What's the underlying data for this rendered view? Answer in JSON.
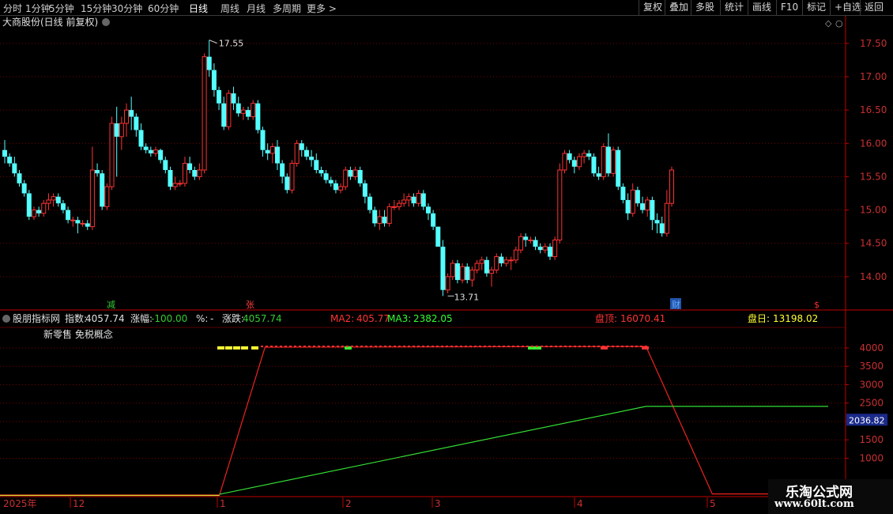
{
  "toolbar": {
    "periods": [
      "分时",
      "1分钟",
      "5分钟",
      "15分钟",
      "30分钟",
      "60分钟",
      "日线",
      "周线",
      "月线",
      "多周期",
      "更多 >"
    ],
    "active_period": "日线",
    "right_buttons": [
      "复权",
      "叠加",
      "多股",
      "统计",
      "画线",
      "F10",
      "标记",
      "+自选",
      "返回"
    ]
  },
  "main_panel": {
    "title": "大商股份(日线 前复权)",
    "y_axis_ticks": [
      "17.50",
      "17.00",
      "16.50",
      "16.00",
      "15.50",
      "15.00",
      "14.50",
      "14.00"
    ],
    "high_label": "17.55",
    "low_label": "13.71",
    "markers": [
      {
        "text": "减",
        "color": "#33cc33"
      },
      {
        "text": "张",
        "color": "#ff4040"
      },
      {
        "text": "财",
        "color": "#66aaff"
      },
      {
        "text": "$",
        "color": "#ff3030"
      }
    ]
  },
  "indicator_panel": {
    "name": "股朋指标网",
    "stats": [
      {
        "label": "指数:",
        "value": "4057.74",
        "color": "#e0e0e0"
      },
      {
        "label": "涨幅:",
        "value": "-100.00",
        "color": "#33cc33"
      },
      {
        "label": "%:",
        "value": "-",
        "color": "#e0e0e0"
      },
      {
        "label": "涨跌:",
        "value": "4057.74",
        "color": "#33cc33"
      }
    ],
    "ma": [
      {
        "label": "MA2:",
        "value": "405.77",
        "color": "#ff3333"
      },
      {
        "label": "MA3:",
        "value": "2382.05",
        "color": "#33ff33"
      }
    ],
    "pan_top": {
      "label": "盘顶:",
      "value": "16070.41",
      "color": "#ff3333"
    },
    "pan_day": {
      "label": "盘日:",
      "value": "13198.02",
      "color": "#ffff33"
    },
    "concept_label": "新零售 免税概念",
    "y_axis_ticks": [
      "4000",
      "3500",
      "3000",
      "2500",
      "2000",
      "1500",
      "1000"
    ],
    "current_value_box": "2036.82"
  },
  "x_axis": {
    "year_label": "2025年",
    "months": [
      "12",
      "1",
      "2",
      "3",
      "4",
      "5"
    ]
  },
  "watermark": {
    "line1": "乐淘公式网",
    "line2": "www.60lt.com"
  },
  "colors": {
    "up": "#ff3232",
    "down": "#54ffff",
    "grid": "#7a0000",
    "axis": "#c00000",
    "ma_green": "#33dd33",
    "ma_red": "#ee2222"
  },
  "chart_data": {
    "type": "candlestick",
    "ylim": [
      13.5,
      17.7
    ],
    "ohlc": [
      [
        15.9,
        16.05,
        15.7,
        15.8
      ],
      [
        15.8,
        15.85,
        15.65,
        15.7
      ],
      [
        15.7,
        15.8,
        15.5,
        15.55
      ],
      [
        15.55,
        15.6,
        15.35,
        15.4
      ],
      [
        15.4,
        15.45,
        15.2,
        15.25
      ],
      [
        15.25,
        15.3,
        14.85,
        14.9
      ],
      [
        14.9,
        15.05,
        14.85,
        15.0
      ],
      [
        15.0,
        15.05,
        14.9,
        14.95
      ],
      [
        14.95,
        15.15,
        14.9,
        15.1
      ],
      [
        15.1,
        15.25,
        15.0,
        15.15
      ],
      [
        15.15,
        15.25,
        15.05,
        15.2
      ],
      [
        15.2,
        15.25,
        15.05,
        15.1
      ],
      [
        15.1,
        15.15,
        14.95,
        15.0
      ],
      [
        15.0,
        15.05,
        14.8,
        14.85
      ],
      [
        14.85,
        14.9,
        14.75,
        14.85
      ],
      [
        14.85,
        14.9,
        14.65,
        14.8
      ],
      [
        14.8,
        14.85,
        14.75,
        14.8
      ],
      [
        14.8,
        14.85,
        14.7,
        14.75
      ],
      [
        14.75,
        15.95,
        14.7,
        15.6
      ],
      [
        15.6,
        15.7,
        15.5,
        15.55
      ],
      [
        15.55,
        15.6,
        15.0,
        15.05
      ],
      [
        15.05,
        15.4,
        15.0,
        15.35
      ],
      [
        15.35,
        16.4,
        15.3,
        16.3
      ],
      [
        16.3,
        16.55,
        15.5,
        16.1
      ],
      [
        16.1,
        16.4,
        15.9,
        16.3
      ],
      [
        16.3,
        16.6,
        16.1,
        16.5
      ],
      [
        16.5,
        16.7,
        16.2,
        16.4
      ],
      [
        16.4,
        16.45,
        16.1,
        16.2
      ],
      [
        16.2,
        16.3,
        15.9,
        15.95
      ],
      [
        15.95,
        16.0,
        15.85,
        15.9
      ],
      [
        15.9,
        15.95,
        15.8,
        15.85
      ],
      [
        15.85,
        15.95,
        15.8,
        15.9
      ],
      [
        15.9,
        15.92,
        15.7,
        15.75
      ],
      [
        15.75,
        15.8,
        15.55,
        15.6
      ],
      [
        15.6,
        15.65,
        15.3,
        15.35
      ],
      [
        15.35,
        15.5,
        15.3,
        15.4
      ],
      [
        15.4,
        15.45,
        15.35,
        15.4
      ],
      [
        15.4,
        15.8,
        15.35,
        15.7
      ],
      [
        15.7,
        15.8,
        15.55,
        15.6
      ],
      [
        15.6,
        15.65,
        15.45,
        15.5
      ],
      [
        15.5,
        15.7,
        15.45,
        15.6
      ],
      [
        15.6,
        17.35,
        15.55,
        17.3
      ],
      [
        17.3,
        17.55,
        17.0,
        17.1
      ],
      [
        17.1,
        17.2,
        16.7,
        16.8
      ],
      [
        16.8,
        16.85,
        16.5,
        16.6
      ],
      [
        16.6,
        16.7,
        16.2,
        16.25
      ],
      [
        16.25,
        16.8,
        16.2,
        16.75
      ],
      [
        16.75,
        16.85,
        16.5,
        16.6
      ],
      [
        16.6,
        16.7,
        16.4,
        16.45
      ],
      [
        16.45,
        16.55,
        16.35,
        16.5
      ],
      [
        16.5,
        16.55,
        16.35,
        16.4
      ],
      [
        16.4,
        16.65,
        16.35,
        16.6
      ],
      [
        16.6,
        16.65,
        16.15,
        16.2
      ],
      [
        16.2,
        16.25,
        15.8,
        15.9
      ],
      [
        15.9,
        16.0,
        15.75,
        15.85
      ],
      [
        15.85,
        16.0,
        15.7,
        15.95
      ],
      [
        15.95,
        16.05,
        15.6,
        15.7
      ],
      [
        15.7,
        15.75,
        15.4,
        15.5
      ],
      [
        15.5,
        15.55,
        15.25,
        15.3
      ],
      [
        15.3,
        15.75,
        15.25,
        15.7
      ],
      [
        15.7,
        16.05,
        15.65,
        16.0
      ],
      [
        16.0,
        16.05,
        15.8,
        15.9
      ],
      [
        15.9,
        15.95,
        15.75,
        15.8
      ],
      [
        15.8,
        15.9,
        15.65,
        15.75
      ],
      [
        15.75,
        15.85,
        15.55,
        15.6
      ],
      [
        15.6,
        15.65,
        15.5,
        15.55
      ],
      [
        15.55,
        15.6,
        15.4,
        15.45
      ],
      [
        15.45,
        15.5,
        15.35,
        15.4
      ],
      [
        15.4,
        15.45,
        15.25,
        15.3
      ],
      [
        15.3,
        15.4,
        15.25,
        15.35
      ],
      [
        15.35,
        15.65,
        15.3,
        15.6
      ],
      [
        15.6,
        15.65,
        15.45,
        15.5
      ],
      [
        15.5,
        15.65,
        15.45,
        15.6
      ],
      [
        15.6,
        15.65,
        15.35,
        15.4
      ],
      [
        15.4,
        15.45,
        15.1,
        15.2
      ],
      [
        15.2,
        15.25,
        14.95,
        15.0
      ],
      [
        15.0,
        15.05,
        14.75,
        14.8
      ],
      [
        14.8,
        15.0,
        14.7,
        14.9
      ],
      [
        14.9,
        15.0,
        14.75,
        14.8
      ],
      [
        14.8,
        15.1,
        14.75,
        15.05
      ],
      [
        15.05,
        15.15,
        15.0,
        15.05
      ],
      [
        15.05,
        15.15,
        15.0,
        15.1
      ],
      [
        15.1,
        15.25,
        15.05,
        15.15
      ],
      [
        15.15,
        15.25,
        15.05,
        15.2
      ],
      [
        15.2,
        15.25,
        15.05,
        15.1
      ],
      [
        15.1,
        15.3,
        15.05,
        15.25
      ],
      [
        15.25,
        15.3,
        15.0,
        15.05
      ],
      [
        15.05,
        15.1,
        14.85,
        14.95
      ],
      [
        14.95,
        15.0,
        14.7,
        14.75
      ],
      [
        14.75,
        14.75,
        14.5,
        14.45
      ],
      [
        14.45,
        14.55,
        13.71,
        13.8
      ],
      [
        13.8,
        14.05,
        13.75,
        14.0
      ],
      [
        14.0,
        14.25,
        13.95,
        14.2
      ],
      [
        14.2,
        14.25,
        13.9,
        13.95
      ],
      [
        13.95,
        14.2,
        13.9,
        14.15
      ],
      [
        14.15,
        14.2,
        13.9,
        13.95
      ],
      [
        13.95,
        14.15,
        13.85,
        14.1
      ],
      [
        14.1,
        14.25,
        14.05,
        14.2
      ],
      [
        14.2,
        14.3,
        14.1,
        14.25
      ],
      [
        14.25,
        14.3,
        14.0,
        14.05
      ],
      [
        14.05,
        14.15,
        13.85,
        14.1
      ],
      [
        14.1,
        14.35,
        14.05,
        14.3
      ],
      [
        14.3,
        14.35,
        14.15,
        14.2
      ],
      [
        14.2,
        14.3,
        14.15,
        14.25
      ],
      [
        14.25,
        14.3,
        14.1,
        14.25
      ],
      [
        14.25,
        14.45,
        14.2,
        14.4
      ],
      [
        14.4,
        14.65,
        14.35,
        14.6
      ],
      [
        14.6,
        14.65,
        14.45,
        14.55
      ],
      [
        14.55,
        14.6,
        14.5,
        14.55
      ],
      [
        14.55,
        14.6,
        14.4,
        14.45
      ],
      [
        14.45,
        14.5,
        14.35,
        14.4
      ],
      [
        14.4,
        14.5,
        14.35,
        14.45
      ],
      [
        14.45,
        14.5,
        14.25,
        14.3
      ],
      [
        14.3,
        14.6,
        14.25,
        14.55
      ],
      [
        14.55,
        15.7,
        14.5,
        15.6
      ],
      [
        15.6,
        15.9,
        15.55,
        15.85
      ],
      [
        15.85,
        15.9,
        15.7,
        15.75
      ],
      [
        15.75,
        15.8,
        15.55,
        15.65
      ],
      [
        15.65,
        15.85,
        15.6,
        15.8
      ],
      [
        15.8,
        15.9,
        15.7,
        15.85
      ],
      [
        15.85,
        15.9,
        15.75,
        15.8
      ],
      [
        15.8,
        15.85,
        15.5,
        15.55
      ],
      [
        15.55,
        15.65,
        15.45,
        15.5
      ],
      [
        15.5,
        16.0,
        15.45,
        15.95
      ],
      [
        15.95,
        16.15,
        15.5,
        15.55
      ],
      [
        15.55,
        15.95,
        15.5,
        15.9
      ],
      [
        15.9,
        15.95,
        15.3,
        15.35
      ],
      [
        15.35,
        15.4,
        15.1,
        15.15
      ],
      [
        15.15,
        15.25,
        14.85,
        14.95
      ],
      [
        14.95,
        15.4,
        14.9,
        15.3
      ],
      [
        15.3,
        15.35,
        15.05,
        15.1
      ],
      [
        15.1,
        15.2,
        14.95,
        15.0
      ],
      [
        15.0,
        15.2,
        14.9,
        15.15
      ],
      [
        15.15,
        15.2,
        14.7,
        14.85
      ],
      [
        14.85,
        14.95,
        14.65,
        14.8
      ],
      [
        14.8,
        14.9,
        14.6,
        14.65
      ],
      [
        14.65,
        15.3,
        14.6,
        15.1
      ],
      [
        15.1,
        15.65,
        15.05,
        15.6
      ]
    ],
    "indicator": {
      "ylim": [
        500,
        4300
      ],
      "x_range_label": "Dec 2024 – May 2025",
      "red_line": [
        [
          0,
          0
        ],
        [
          0.265,
          0
        ],
        [
          0.32,
          4020
        ],
        [
          0.78,
          4040
        ],
        [
          0.86,
          30
        ],
        [
          1.0,
          30
        ]
      ],
      "green_line": [
        [
          0.265,
          20
        ],
        [
          0.78,
          2410
        ],
        [
          1.0,
          2410
        ]
      ]
    }
  }
}
